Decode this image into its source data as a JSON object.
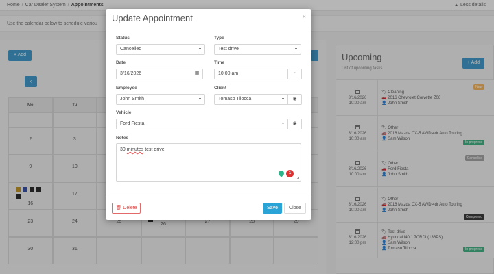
{
  "topbar": {
    "breadcrumb": [
      "Home",
      "Car Dealer System",
      "Appointments"
    ],
    "less_details": "Less details"
  },
  "info": {
    "text": "Use the calendar below to schedule variou"
  },
  "calendar": {
    "add_label": "+ Add",
    "prev_icon": "chevron-left-icon",
    "weekdays": [
      "Mo",
      "Tu",
      "",
      "",
      "",
      "",
      ""
    ],
    "rows": [
      [
        "2",
        "3",
        "",
        "",
        "",
        "",
        ""
      ],
      [
        "9",
        "10",
        "",
        "",
        "",
        "",
        ""
      ],
      [
        "16",
        "17",
        "",
        "",
        "",
        "",
        ""
      ],
      [
        "23",
        "24",
        "25",
        "26",
        "27",
        "28",
        "29"
      ],
      [
        "30",
        "31",
        "",
        "",
        "",
        "",
        ""
      ]
    ],
    "event_colors": [
      "#b8860b",
      "#1f3c99",
      "#111111",
      "#111111",
      "#111111"
    ]
  },
  "upcoming": {
    "title": "Upcoming",
    "subtitle": "List of upcoming tasks",
    "add_label": "+ Add",
    "items": [
      {
        "date": "3/16/2026",
        "time": "10:00 am",
        "type": "Cleaning",
        "vehicle": "2016 Chevrolet Corvette Z06",
        "people": [
          "John Smith"
        ],
        "status": "New",
        "status_color": "#f0ad4e"
      },
      {
        "date": "3/16/2026",
        "time": "10:00 am",
        "type": "Other",
        "vehicle": "2016 Mazda CX-5 AWD 4dr Auto Touring",
        "people": [
          "Sam Wilson"
        ],
        "status": "In progress",
        "status_color": "#2aa876"
      },
      {
        "date": "3/16/2026",
        "time": "10:00 am",
        "type": "Other",
        "vehicle": "Ford Fiesta",
        "people": [
          "John Smith"
        ],
        "status": "Cancelled",
        "status_color": "#999999"
      },
      {
        "date": "3/16/2026",
        "time": "10:00 am",
        "type": "Other",
        "vehicle": "2016 Mazda CX-5 AWD 4dr Auto Touring",
        "people": [
          "John Smith"
        ],
        "status": "Completed",
        "status_color": "#222222"
      },
      {
        "date": "3/16/2026",
        "time": "12:00 pm",
        "type": "Test drive",
        "vehicle": "Hyundai i40 1.7CRDI (136PS)",
        "people": [
          "Sam Wilson",
          "Tomaso Tilocca"
        ],
        "status": "In progress",
        "status_color": "#2aa876"
      }
    ]
  },
  "modal": {
    "title": "Update Appointment",
    "close_glyph": "×",
    "status_label": "Status",
    "status_value": "Cancelled",
    "type_label": "Type",
    "type_value": "Test drive",
    "date_label": "Date",
    "date_value": "3/16/2026",
    "time_label": "Time",
    "time_value": "10:00 am",
    "employee_label": "Employee",
    "employee_value": "John Smith",
    "client_label": "Client",
    "client_value": "Tomaso Tilocca",
    "vehicle_label": "Vehicle",
    "vehicle_value": "Ford Fiesta",
    "notes_label": "Notes",
    "notes_value_a": "30 ",
    "notes_value_b": "minutes",
    "notes_value_c": " test drive",
    "notif_count": "1",
    "delete_label": "Delete",
    "save_label": "Save",
    "close_label": "Close"
  }
}
